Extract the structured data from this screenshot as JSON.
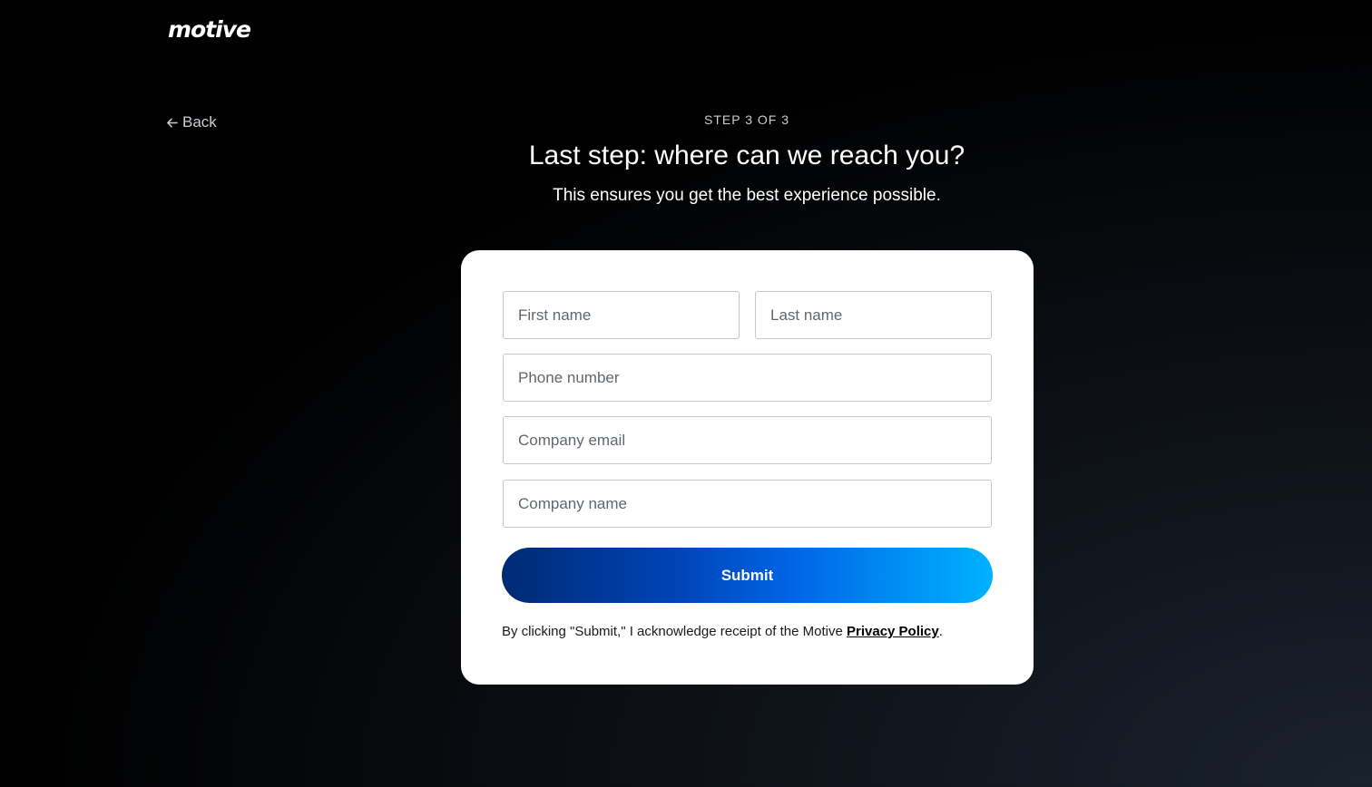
{
  "brand": {
    "logo_text": "motive"
  },
  "nav": {
    "back_label": "Back"
  },
  "header": {
    "step": "STEP 3 OF 3",
    "title": "Last step: where can we reach you?",
    "subtitle": "This ensures you get the best experience possible."
  },
  "form": {
    "first_name": {
      "placeholder": "First name",
      "value": ""
    },
    "last_name": {
      "placeholder": "Last name",
      "value": ""
    },
    "phone": {
      "placeholder": "Phone number",
      "value": ""
    },
    "email": {
      "placeholder": "Company email",
      "value": ""
    },
    "company": {
      "placeholder": "Company name",
      "value": ""
    },
    "submit_label": "Submit",
    "legal_prefix": "By clicking \"Submit,\" I acknowledge receipt of the Motive ",
    "privacy_link": "Privacy Policy",
    "legal_suffix": "."
  },
  "colors": {
    "button_gradient_start": "#002a73",
    "button_gradient_end": "#00b2ff",
    "page_background": "#000000",
    "card_background": "#ffffff"
  }
}
